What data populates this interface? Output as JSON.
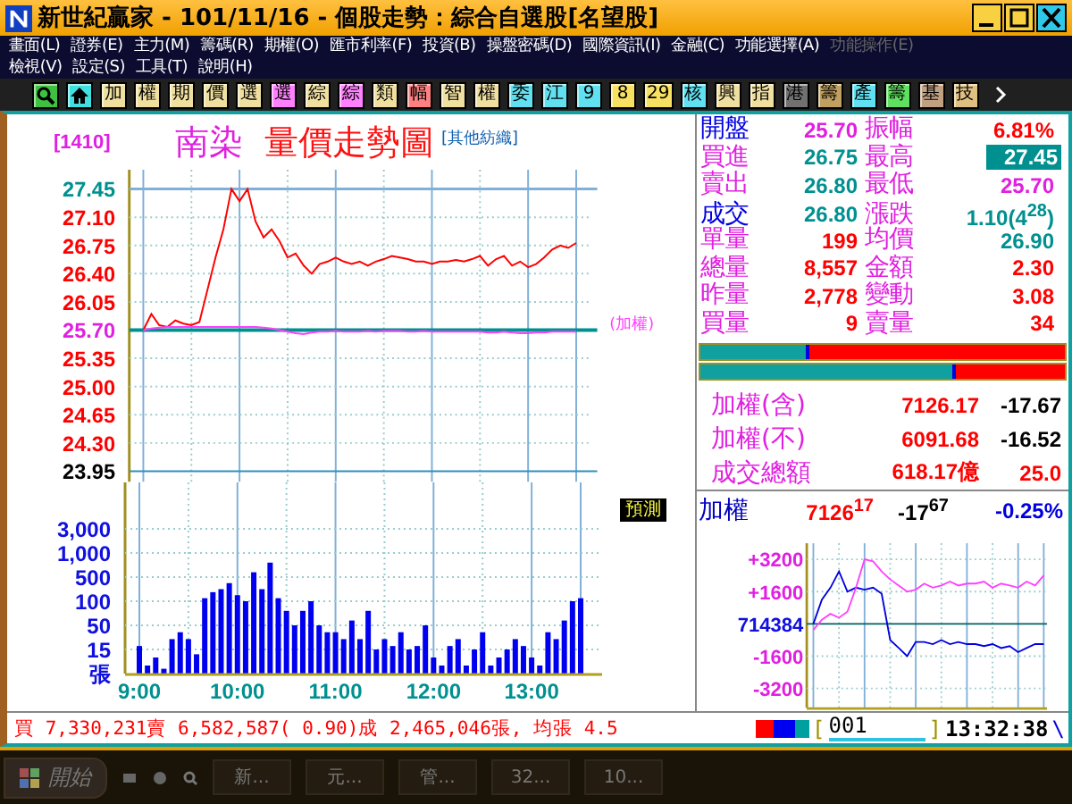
{
  "window": {
    "title": "新世紀贏家 - 101/11/16 - 個股走勢：綜合自選股[名望股]"
  },
  "menu_rows": [
    [
      {
        "label": "畫面(L)",
        "disabled": false
      },
      {
        "label": "證券(E)",
        "disabled": false
      },
      {
        "label": "主力(M)",
        "disabled": false
      },
      {
        "label": "籌碼(R)",
        "disabled": false
      },
      {
        "label": "期權(O)",
        "disabled": false
      },
      {
        "label": "匯市利率(F)",
        "disabled": false
      },
      {
        "label": "投資(B)",
        "disabled": false
      },
      {
        "label": "操盤密碼(D)",
        "disabled": false
      },
      {
        "label": "國際資訊(I)",
        "disabled": false
      },
      {
        "label": "金融(C)",
        "disabled": false
      },
      {
        "label": "功能選擇(A)",
        "disabled": false
      },
      {
        "label": "功能操作(E)",
        "disabled": true
      }
    ],
    [
      {
        "label": "檢視(V)",
        "disabled": false
      },
      {
        "label": "設定(S)",
        "disabled": false
      },
      {
        "label": "工具(T)",
        "disabled": false
      },
      {
        "label": "說明(H)",
        "disabled": false
      }
    ]
  ],
  "toolbar": [
    {
      "kind": "search",
      "color": "#40c040"
    },
    {
      "kind": "home",
      "color": "#40e0e0"
    },
    {
      "kind": "text",
      "label": "加",
      "color": "#f0e0a0"
    },
    {
      "kind": "text",
      "label": "權",
      "color": "#f0e0a0"
    },
    {
      "kind": "text",
      "label": "期",
      "color": "#f0e0a0"
    },
    {
      "kind": "text",
      "label": "價",
      "color": "#f0e0a0"
    },
    {
      "kind": "text",
      "label": "選",
      "color": "#f0e0a0"
    },
    {
      "kind": "text",
      "label": "選",
      "color": "#ff80ff"
    },
    {
      "kind": "text",
      "label": "綜",
      "color": "#f0e0a0"
    },
    {
      "kind": "text",
      "label": "綜",
      "color": "#ff80ff"
    },
    {
      "kind": "text",
      "label": "類",
      "color": "#f0e0a0"
    },
    {
      "kind": "text",
      "label": "幅",
      "color": "#ff8080"
    },
    {
      "kind": "text",
      "label": "智",
      "color": "#f0e0a0"
    },
    {
      "kind": "text",
      "label": "權",
      "color": "#f0e0a0"
    },
    {
      "kind": "text",
      "label": "委",
      "color": "#60e0f0"
    },
    {
      "kind": "text",
      "label": "江",
      "color": "#60e0f0"
    },
    {
      "kind": "text",
      "label": "9",
      "color": "#60e0f0"
    },
    {
      "kind": "text",
      "label": "8",
      "color": "#f8e060"
    },
    {
      "kind": "text",
      "label": "29",
      "color": "#f8e060"
    },
    {
      "kind": "text",
      "label": "核",
      "color": "#60e0f0"
    },
    {
      "kind": "text",
      "label": "興",
      "color": "#f0e0a0"
    },
    {
      "kind": "text",
      "label": "指",
      "color": "#f0e0a0"
    },
    {
      "kind": "text",
      "label": "港",
      "color": "#707070"
    },
    {
      "kind": "text",
      "label": "籌",
      "color": "#c0a060"
    },
    {
      "kind": "text",
      "label": "產",
      "color": "#60e0f0"
    },
    {
      "kind": "text",
      "label": "籌",
      "color": "#60e060"
    },
    {
      "kind": "text",
      "label": "基",
      "color": "#c0a080"
    },
    {
      "kind": "text",
      "label": "技",
      "color": "#e0c080"
    },
    {
      "kind": "more",
      "color": "#202020"
    }
  ],
  "stock": {
    "code": "[1410]",
    "name": "南染",
    "title": "量價走勢圖",
    "sector": "[其他紡織]"
  },
  "price_chart": {
    "chart_data": {
      "type": "line",
      "grid": true,
      "categories": [
        null,
        null,
        null,
        null,
        null,
        null,
        null,
        null,
        null,
        null,
        null,
        null,
        null,
        null,
        null,
        null,
        null,
        null,
        null,
        null,
        null,
        null,
        null,
        null,
        null,
        null,
        null,
        null,
        null,
        null,
        null,
        null,
        null,
        null,
        null,
        null,
        null,
        null,
        null,
        null,
        null,
        null,
        null,
        null,
        null,
        null,
        null,
        null,
        null,
        null,
        null,
        null,
        null,
        null,
        null
      ],
      "series": [
        {
          "color": "#ff0000",
          "values": [
            25.7,
            25.9,
            25.76,
            25.74,
            25.82,
            25.78,
            25.76,
            25.8,
            26.2,
            26.6,
            26.95,
            27.45,
            27.3,
            27.45,
            27.05,
            26.85,
            26.95,
            26.8,
            26.6,
            26.65,
            26.5,
            26.4,
            26.52,
            26.55,
            26.6,
            26.55,
            26.52,
            26.55,
            26.5,
            26.55,
            26.58,
            26.62,
            26.6,
            26.58,
            26.55,
            26.55,
            26.52,
            26.55,
            26.55,
            26.57,
            26.55,
            26.58,
            26.62,
            26.5,
            26.58,
            26.62,
            26.5,
            26.55,
            26.48,
            26.52,
            26.6,
            26.7,
            26.75,
            26.72,
            26.78
          ]
        },
        {
          "name": "(加權)",
          "color": "#ff40ff",
          "values": [
            25.7,
            25.72,
            25.73,
            25.74,
            25.74,
            25.74,
            25.74,
            25.74,
            25.74,
            25.74,
            25.74,
            25.74,
            25.74,
            25.74,
            25.74,
            25.73,
            25.72,
            25.7,
            25.68,
            25.66,
            25.65,
            25.67,
            25.68,
            25.68,
            25.69,
            25.68,
            25.68,
            25.68,
            25.69,
            25.68,
            25.69,
            25.69,
            25.69,
            25.68,
            25.68,
            25.69,
            25.68,
            25.68,
            25.68,
            25.68,
            25.68,
            25.68,
            25.68,
            25.67,
            25.67,
            25.68,
            25.67,
            25.66,
            25.66,
            25.67,
            25.67,
            25.68,
            25.68,
            25.68,
            25.68
          ]
        }
      ],
      "ylim": [
        23.95,
        27.45
      ],
      "yticks": [
        {
          "value": 27.45,
          "label": "27.45"
        },
        {
          "value": 27.1,
          "label": "27.10"
        },
        {
          "value": 26.75,
          "label": "26.75"
        },
        {
          "value": 26.4,
          "label": "26.40"
        },
        {
          "value": 26.05,
          "label": "26.05"
        },
        {
          "value": 25.7,
          "label": "25.70"
        },
        {
          "value": 25.35,
          "label": "25.35"
        },
        {
          "value": 25,
          "label": "25.00"
        },
        {
          "value": 24.65,
          "label": "24.65"
        },
        {
          "value": 24.3,
          "label": "24.30"
        },
        {
          "value": 23.95,
          "label": "23.95"
        }
      ]
    }
  },
  "forecast_badge": "預測",
  "volume_axis": {
    "labels": [
      "3,000",
      "1,000",
      "500",
      "100",
      "50",
      "15",
      "張"
    ],
    "time_labels": [
      "9:00",
      "10:00",
      "11:00",
      "12:00",
      "13:00"
    ]
  },
  "quote_rows": [
    {
      "left": {
        "label": "開盤",
        "emphasis": true,
        "value": "25.70",
        "color": "#e020e0",
        "highlighted": false
      },
      "right": {
        "label": "振幅",
        "emphasis": false,
        "value": "6.81%",
        "color": "#ff0000",
        "highlighted": false
      }
    },
    {
      "left": {
        "label": "買進",
        "emphasis": false,
        "value": "26.75",
        "color": "#009090",
        "highlighted": false
      },
      "right": {
        "label": "最高",
        "emphasis": false,
        "value": "27.45",
        "color": "#009090",
        "highlighted": true
      }
    },
    {
      "left": {
        "label": "賣出",
        "emphasis": false,
        "value": "26.80",
        "color": "#009090",
        "highlighted": false
      },
      "right": {
        "label": "最低",
        "emphasis": false,
        "value": "25.70",
        "color": "#e020e0",
        "highlighted": false
      }
    },
    {
      "left": {
        "label": "成交",
        "emphasis": true,
        "value": "26.80",
        "color": "#009090",
        "highlighted": false
      },
      "right": {
        "label": "漲跌",
        "emphasis": false,
        "value": "1.10(4$^{28}$)",
        "color": "#009090",
        "highlighted": false
      }
    },
    {
      "left": {
        "label": "單量",
        "emphasis": false,
        "value": "199",
        "color": "#ff0000",
        "highlighted": false
      },
      "right": {
        "label": "均價",
        "emphasis": false,
        "value": "26.90",
        "color": "#009090",
        "highlighted": false
      }
    },
    {
      "left": {
        "label": "總量",
        "emphasis": false,
        "value": "8,557",
        "color": "#ff0000",
        "highlighted": false
      },
      "right": {
        "label": "金額",
        "emphasis": false,
        "value": "2.30",
        "color": "#ff0000",
        "highlighted": false
      }
    },
    {
      "left": {
        "label": "昨量",
        "emphasis": false,
        "value": "2,778",
        "color": "#ff0000",
        "highlighted": false
      },
      "right": {
        "label": "變動",
        "emphasis": false,
        "value": "3.08",
        "color": "#ff0000",
        "highlighted": false
      }
    },
    {
      "left": {
        "label": "買量",
        "emphasis": false,
        "value": "9",
        "color": "#ff0000",
        "highlighted": false
      },
      "right": {
        "label": "賣量",
        "emphasis": false,
        "value": "34",
        "color": "#ff0000",
        "highlighted": false
      }
    }
  ],
  "order_bars": [
    {
      "level": 0.3
    },
    {
      "level": 0.7
    }
  ],
  "index_rows": [
    {
      "label": "加權(含)",
      "value": "7126.17",
      "change": "-17.67",
      "color": "#000000"
    },
    {
      "label": "加權(不)",
      "value": "6091.68",
      "change": "-16.52",
      "color": "#000000"
    },
    {
      "label": "成交總額",
      "value": "618.17億",
      "change": "25.0",
      "color": "#ff0000"
    }
  ],
  "index_header": {
    "label": "加權",
    "value": "7126$^{17}$",
    "change": "-17$^{67}$",
    "percent": "-0.25%"
  },
  "index_chart": {
    "reference_label": "714384",
    "chart_data": {
      "type": "line",
      "grid": true,
      "categories": [
        null,
        null,
        null,
        null,
        null,
        null,
        null,
        null,
        null,
        null,
        null,
        null,
        null,
        null,
        null,
        null,
        null,
        null,
        null,
        null,
        null,
        null,
        null,
        null,
        null,
        null,
        null,
        null
      ],
      "series": [
        {
          "color": "#0000e0",
          "values": [
            0,
            1200,
            1800,
            2600,
            1600,
            1800,
            1700,
            1800,
            1500,
            -800,
            -1200,
            -1600,
            -900,
            -900,
            -1000,
            -800,
            -1000,
            -900,
            -1000,
            -1000,
            -1100,
            -1000,
            -1200,
            -1100,
            -1400,
            -1200,
            -1000,
            -1000
          ]
        },
        {
          "color": "#ff40ff",
          "values": [
            -300,
            200,
            500,
            300,
            600,
            1800,
            3200,
            3100,
            2600,
            2200,
            1900,
            1600,
            1700,
            2000,
            1800,
            1900,
            2100,
            1900,
            2000,
            2000,
            2100,
            1800,
            2000,
            1900,
            1800,
            2100,
            1900,
            2400
          ]
        }
      ],
      "ylim": [
        -4000,
        4000
      ],
      "yticks": [
        {
          "value": 3200,
          "label": "+3200"
        },
        {
          "value": 1600,
          "label": "+1600"
        },
        {
          "value": -1600,
          "label": "-1600"
        },
        {
          "value": -3200,
          "label": "-3200"
        }
      ]
    }
  },
  "status_bar": {
    "text": "買 7,330,231賣 6,582,587( 0.90)成 2,465,046張, 均張 4.5",
    "bracket_open": "[",
    "page": "001",
    "bracket_close": "]",
    "time": "13:32:38",
    "mark": "\\"
  },
  "taskbar": {
    "start": "開始",
    "tasks": [
      "新...",
      "元...",
      "管...",
      "32...",
      "10..."
    ]
  }
}
